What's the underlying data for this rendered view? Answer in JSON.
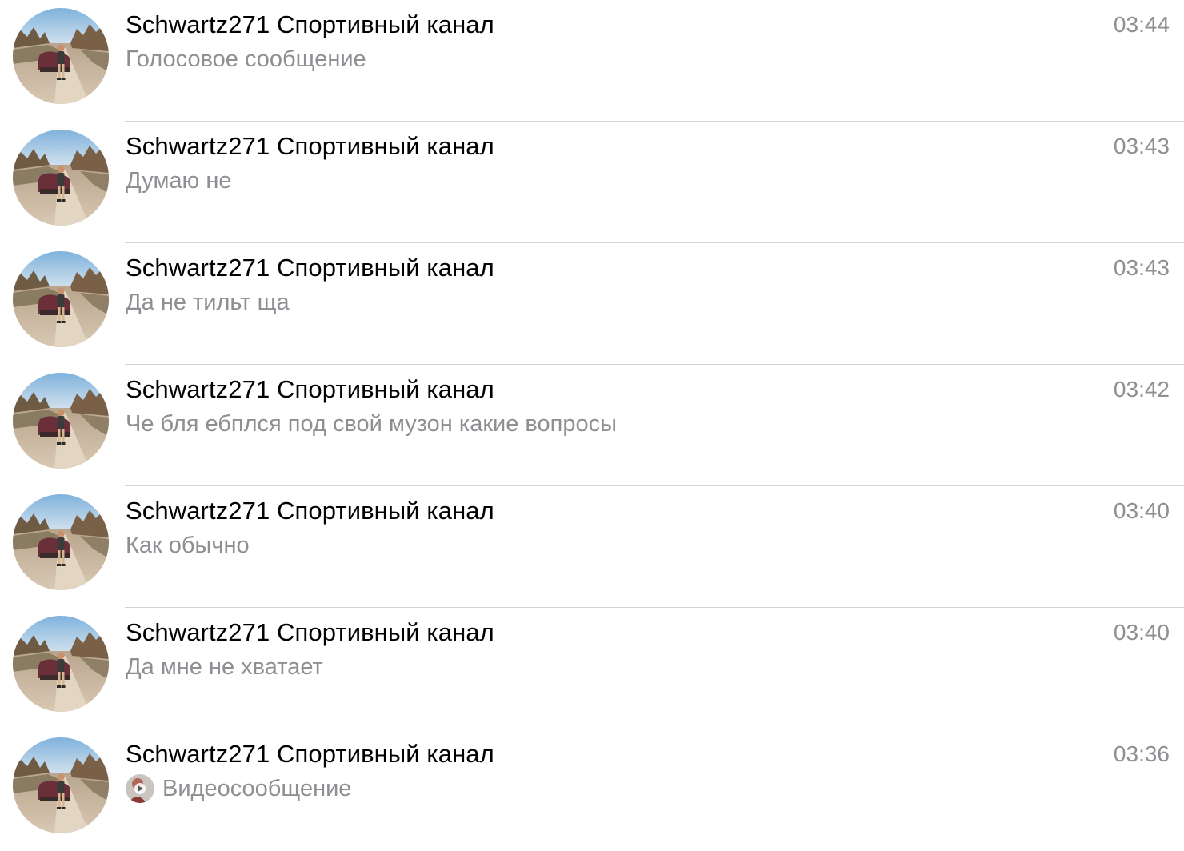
{
  "chats": [
    {
      "name": "Schwartz271 Спортивный канал",
      "time": "03:44",
      "preview": "Голосовое сообщение",
      "avatar_icon": "user-photo-avatar"
    },
    {
      "name": "Schwartz271 Спортивный канал",
      "time": "03:43",
      "preview": "Думаю не",
      "avatar_icon": "user-photo-avatar"
    },
    {
      "name": "Schwartz271 Спортивный канал",
      "time": "03:43",
      "preview": "Да не тильт ща",
      "avatar_icon": "user-photo-avatar"
    },
    {
      "name": "Schwartz271 Спортивный канал",
      "time": "03:42",
      "preview": "Че бля ебплся под свой музон какие вопросы",
      "avatar_icon": "user-photo-avatar"
    },
    {
      "name": "Schwartz271 Спортивный канал",
      "time": "03:40",
      "preview": "Как обычно",
      "avatar_icon": "user-photo-avatar"
    },
    {
      "name": "Schwartz271 Спортивный канал",
      "time": "03:40",
      "preview": "Да мне не хватает",
      "avatar_icon": "user-photo-avatar"
    },
    {
      "name": "Schwartz271 Спортивный канал",
      "time": "03:36",
      "preview": "Видеосообщение",
      "avatar_icon": "user-photo-avatar",
      "preview_icon": "video-message-thumbnail-icon"
    }
  ],
  "colors": {
    "name_text": "#000000",
    "secondary_text": "#8e8e93",
    "divider": "#d3d3d6",
    "background": "#ffffff"
  }
}
